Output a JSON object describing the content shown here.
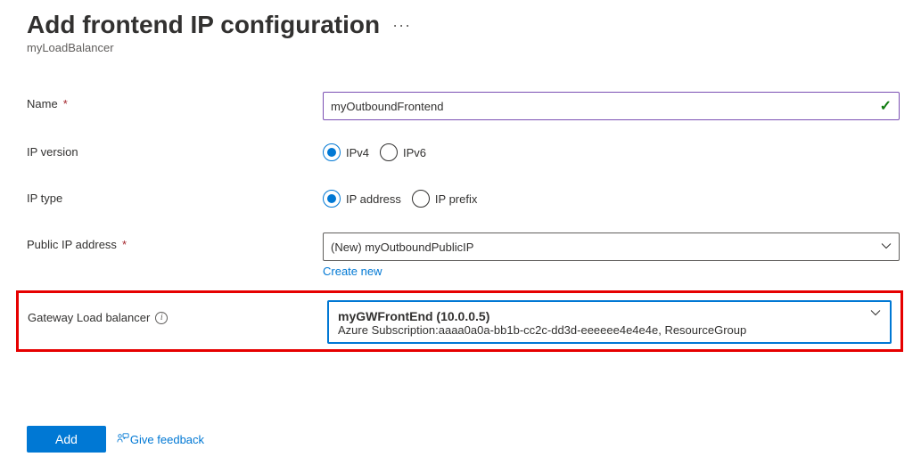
{
  "header": {
    "title": "Add frontend IP configuration",
    "subtitle": "myLoadBalancer"
  },
  "form": {
    "name": {
      "label": "Name",
      "value": "myOutboundFrontend"
    },
    "ipVersion": {
      "label": "IP version",
      "options": {
        "ipv4": "IPv4",
        "ipv6": "IPv6"
      },
      "selected": "ipv4"
    },
    "ipType": {
      "label": "IP type",
      "options": {
        "address": "IP address",
        "prefix": "IP prefix"
      },
      "selected": "address"
    },
    "publicIp": {
      "label": "Public IP address",
      "value": "(New) myOutboundPublicIP",
      "createNew": "Create new"
    },
    "gateway": {
      "label": "Gateway Load balancer",
      "title": "myGWFrontEnd (10.0.0.5)",
      "subPrefix": "Azure Subscription:",
      "subDetail": "aaaa0a0a-bb1b-cc2c-dd3d-eeeeee4e4e4e, ResourceGroup"
    }
  },
  "footer": {
    "addLabel": "Add",
    "feedbackLabel": "Give feedback"
  }
}
